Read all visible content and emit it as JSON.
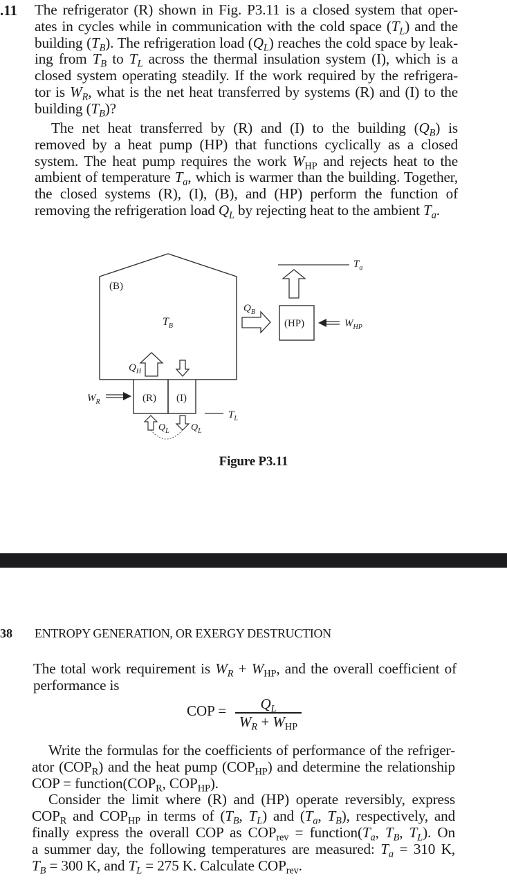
{
  "problem": {
    "number": ".11",
    "p1_lines": [
      [
        "The refrigerator (R) shown in Fig. P3.11 is a closed system that oper-"
      ],
      [
        "ates in cycles while in communication with the cold space (",
        "T_L",
        ") and the"
      ],
      [
        "building (",
        "T_B",
        "). The refrigeration load (",
        "Q_L",
        ") reaches the cold space by leak-"
      ],
      [
        "ing from ",
        "T_B",
        " to ",
        "T_L",
        " across the thermal insulation system (I), which is a"
      ],
      [
        "closed system operating steadily. If the work required by the refrigera-"
      ],
      [
        "tor is ",
        "W_R",
        ", what is the net heat transferred by systems (R) and (I) to the"
      ],
      [
        "building (",
        "T_B",
        ")?"
      ]
    ],
    "p2_lines": [
      [
        "The net heat transferred by (R) and (I) to the building (",
        "Q_B",
        ") is"
      ],
      [
        "removed by a heat pump (HP) that functions cyclically as a closed"
      ],
      [
        "system. The heat pump requires the work ",
        "W_HP",
        " and rejects heat to the"
      ],
      [
        "ambient of temperature ",
        "T_a",
        ", which is warmer than the building. Together,"
      ],
      [
        "the closed systems (R), (I), (B), and (HP) perform the function of"
      ],
      [
        "removing the refrigeration load ",
        "Q_L",
        " by rejecting heat to the ambient ",
        "T_a",
        "."
      ]
    ]
  },
  "figure": {
    "caption": "Figure P3.11",
    "labels": {
      "building": "(B)",
      "building_temp": "T_B",
      "refrigerator": "(R)",
      "insulation": "(I)",
      "heat_pump": "(HP)",
      "heat_rejected_R": "Q_H",
      "heat_to_HP": "Q_B",
      "refrigeration_load_in": "Q_L",
      "refrigeration_load_leak": "Q_L",
      "work_R": "W_R",
      "work_HP": "W_HP",
      "cold_temp": "T_L",
      "ambient_temp": "T_a"
    }
  },
  "page": {
    "number": "38",
    "running_head": "ENTROPY GENERATION, OR EXERGY DESTRUCTION"
  },
  "continuation": {
    "p3_lines": [
      [
        "The total work requirement is ",
        "W_R",
        " + ",
        "W_HP",
        ", and the overall coefficient of"
      ],
      [
        "performance is"
      ]
    ],
    "equation": {
      "lhs": "COP =",
      "numerator": "Q_L",
      "denominator": [
        "W_R",
        " + ",
        "W_HP"
      ]
    },
    "p4_lines": [
      [
        "Write the formulas for the coefficients of performance of the refriger-"
      ],
      [
        "ator (COP",
        "_R",
        ") and the heat pump (COP",
        "_HP",
        ") and determine the relationship"
      ],
      [
        "COP = function(COP",
        "_R",
        ", COP",
        "_HP",
        ")."
      ],
      [
        "Consider the limit where (R) and (HP) operate reversibly, express"
      ],
      [
        "COP",
        "_R",
        " and COP",
        "_HP",
        " in terms of (",
        "T_B",
        ", ",
        "T_L",
        ") and (",
        "T_a",
        ", ",
        "T_B",
        "), respectively, and"
      ],
      [
        "finally express the overall COP as COP",
        "_rev",
        " = function(",
        "T_a",
        ", ",
        "T_B",
        ", ",
        "T_L",
        "). On"
      ],
      [
        "a summer day, the following temperatures are measured: ",
        "T_a",
        " = 310 K,"
      ],
      [
        "T_B",
        " = 300 K, and ",
        "T_L",
        " = 275 K. Calculate COP",
        "_rev",
        "."
      ]
    ]
  }
}
